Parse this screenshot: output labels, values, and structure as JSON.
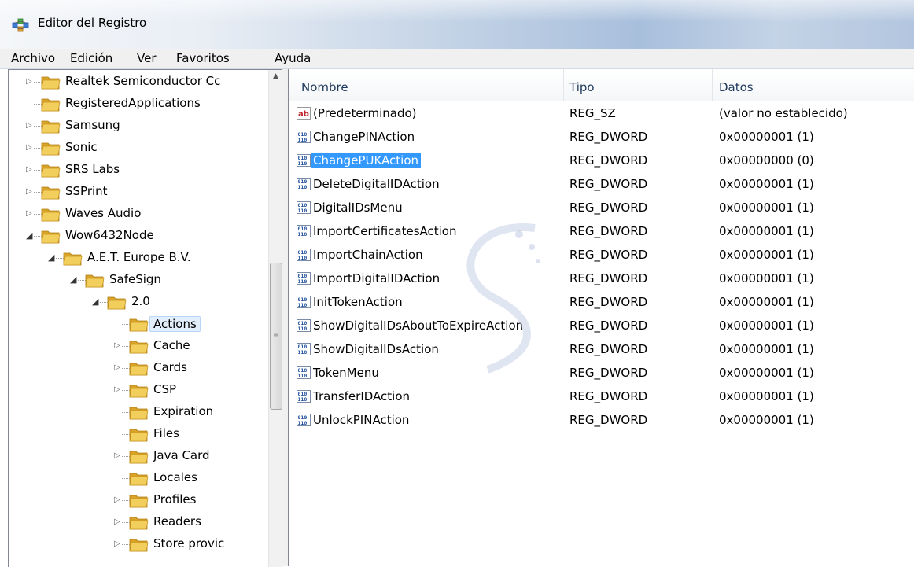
{
  "window": {
    "title": "Editor del Registro"
  },
  "menu": [
    "Archivo",
    "Edición",
    "Ver",
    "Favoritos",
    "Ayuda"
  ],
  "tree": [
    {
      "label": "Realtek Semiconductor Cc",
      "state": "collapsed"
    },
    {
      "label": "RegisteredApplications",
      "state": "leaf"
    },
    {
      "label": "Samsung",
      "state": "collapsed"
    },
    {
      "label": "Sonic",
      "state": "collapsed"
    },
    {
      "label": "SRS Labs",
      "state": "collapsed"
    },
    {
      "label": "SSPrint",
      "state": "collapsed"
    },
    {
      "label": "Waves Audio",
      "state": "collapsed"
    },
    {
      "label": "Wow6432Node",
      "state": "expanded"
    },
    {
      "label": "A.E.T. Europe B.V.",
      "state": "expanded"
    },
    {
      "label": "SafeSign",
      "state": "expanded"
    },
    {
      "label": "2.0",
      "state": "expanded"
    },
    {
      "label": "Actions",
      "state": "leaf",
      "selected": true
    },
    {
      "label": "Cache",
      "state": "collapsed"
    },
    {
      "label": "Cards",
      "state": "collapsed"
    },
    {
      "label": "CSP",
      "state": "collapsed"
    },
    {
      "label": "Expiration",
      "state": "leaf"
    },
    {
      "label": "Files",
      "state": "leaf"
    },
    {
      "label": "Java Card",
      "state": "collapsed"
    },
    {
      "label": "Locales",
      "state": "leaf"
    },
    {
      "label": "Profiles",
      "state": "collapsed"
    },
    {
      "label": "Readers",
      "state": "collapsed"
    },
    {
      "label": "Store provic",
      "state": "collapsed"
    }
  ],
  "list": {
    "columns": [
      "Nombre",
      "Tipo",
      "Datos"
    ],
    "rows": [
      {
        "icon": "string-value-icon",
        "name": "(Predeterminado)",
        "type": "REG_SZ",
        "data": "(valor no establecido)"
      },
      {
        "icon": "dword-value-icon",
        "name": "ChangePINAction",
        "type": "REG_DWORD",
        "data": "0x00000001 (1)"
      },
      {
        "icon": "dword-value-icon",
        "name": "ChangePUKAction",
        "type": "REG_DWORD",
        "data": "0x00000000 (0)",
        "selected": true
      },
      {
        "icon": "dword-value-icon",
        "name": "DeleteDigitalIDAction",
        "type": "REG_DWORD",
        "data": "0x00000001 (1)"
      },
      {
        "icon": "dword-value-icon",
        "name": "DigitalIDsMenu",
        "type": "REG_DWORD",
        "data": "0x00000001 (1)"
      },
      {
        "icon": "dword-value-icon",
        "name": "ImportCertificatesAction",
        "type": "REG_DWORD",
        "data": "0x00000001 (1)"
      },
      {
        "icon": "dword-value-icon",
        "name": "ImportChainAction",
        "type": "REG_DWORD",
        "data": "0x00000001 (1)"
      },
      {
        "icon": "dword-value-icon",
        "name": "ImportDigitalIDAction",
        "type": "REG_DWORD",
        "data": "0x00000001 (1)"
      },
      {
        "icon": "dword-value-icon",
        "name": "InitTokenAction",
        "type": "REG_DWORD",
        "data": "0x00000001 (1)"
      },
      {
        "icon": "dword-value-icon",
        "name": "ShowDigitalIDsAboutToExpireAction",
        "type": "REG_DWORD",
        "data": "0x00000001 (1)"
      },
      {
        "icon": "dword-value-icon",
        "name": "ShowDigitalIDsAction",
        "type": "REG_DWORD",
        "data": "0x00000001 (1)"
      },
      {
        "icon": "dword-value-icon",
        "name": "TokenMenu",
        "type": "REG_DWORD",
        "data": "0x00000001 (1)"
      },
      {
        "icon": "dword-value-icon",
        "name": "TransferIDAction",
        "type": "REG_DWORD",
        "data": "0x00000001 (1)"
      },
      {
        "icon": "dword-value-icon",
        "name": "UnlockPINAction",
        "type": "REG_DWORD",
        "data": "0x00000001 (1)"
      }
    ]
  },
  "colors": {
    "selection": "#3399ff",
    "folder": "#e8b83a",
    "header_text": "#1e395b"
  }
}
